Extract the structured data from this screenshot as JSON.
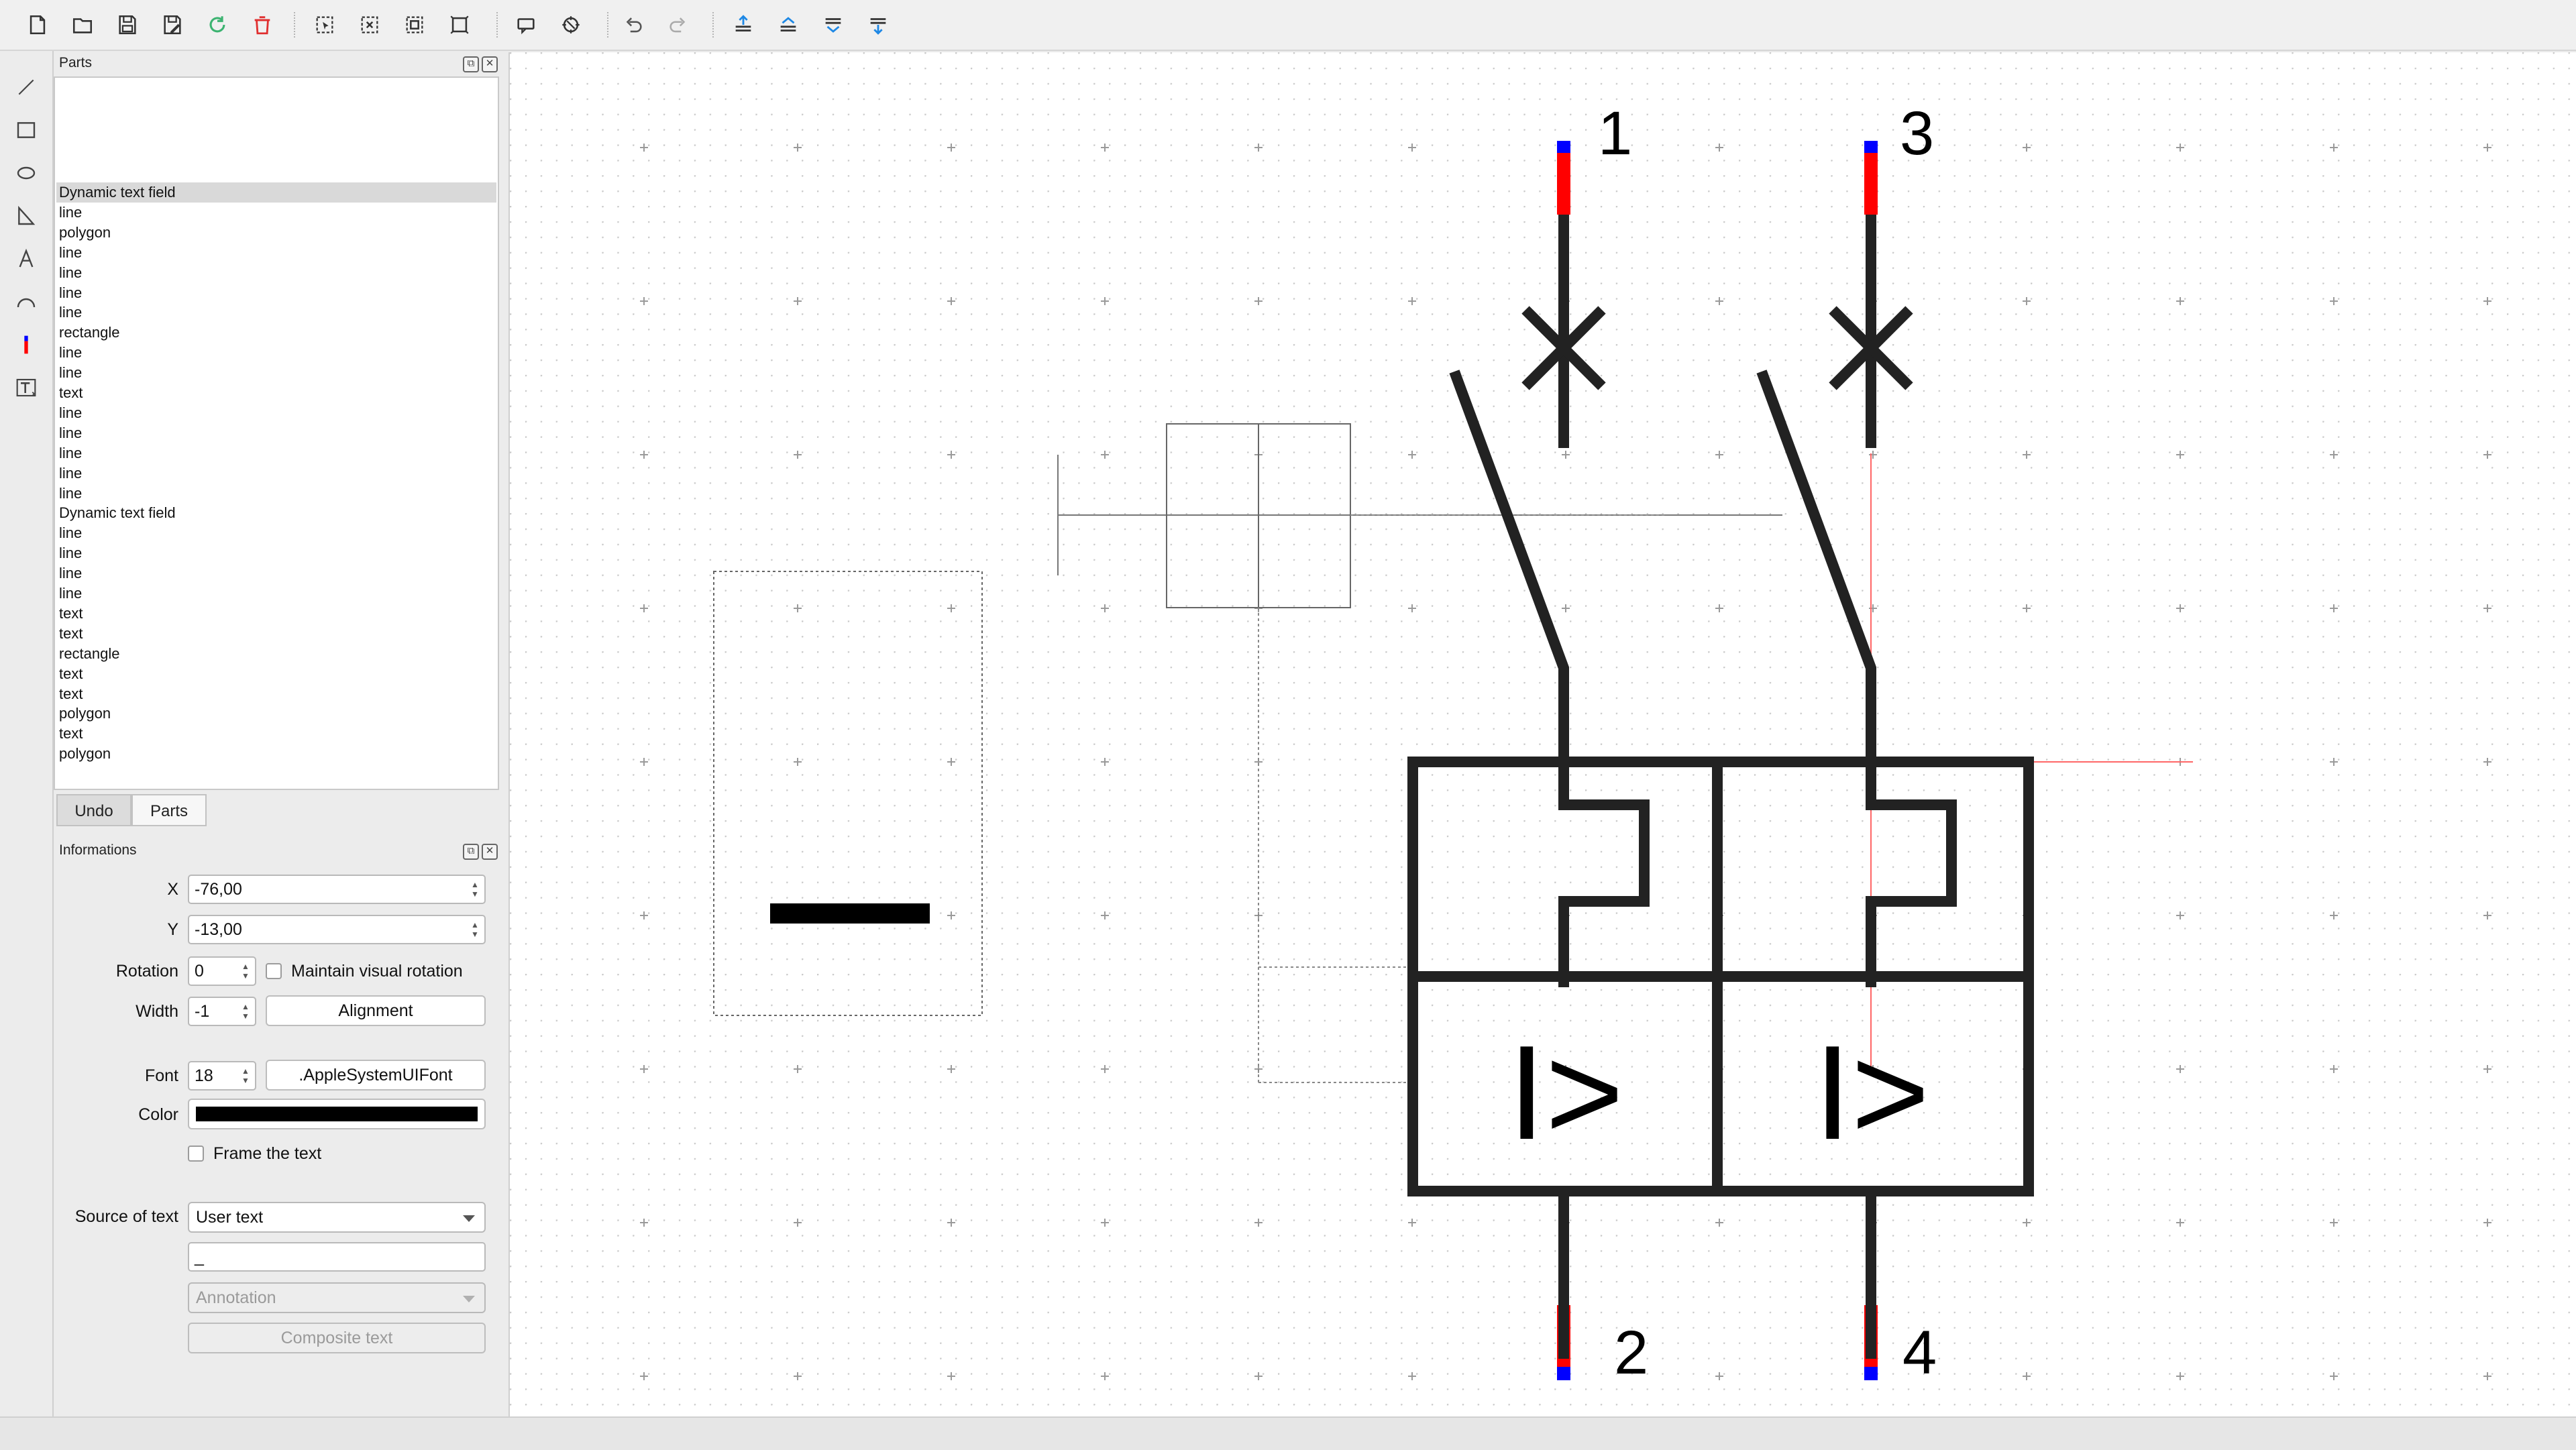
{
  "parts_panel": {
    "title": "Parts",
    "items": [
      "Dynamic text field",
      "line",
      "polygon",
      "line",
      "line",
      "line",
      "line",
      "rectangle",
      "line",
      "line",
      "text",
      "line",
      "line",
      "line",
      "line",
      "line",
      "Dynamic text field",
      "line",
      "line",
      "line",
      "line",
      "text",
      "text",
      "rectangle",
      "text",
      "text",
      "polygon",
      "text",
      "polygon"
    ],
    "selected_index": 0
  },
  "tabs": {
    "undo": "Undo",
    "parts": "Parts"
  },
  "info_panel": {
    "title": "Informations",
    "x_label": "X",
    "x_value": "-76,00",
    "y_label": "Y",
    "y_value": "-13,00",
    "rotation_label": "Rotation",
    "rotation_value": "0",
    "maintain_label": "Maintain visual rotation",
    "width_label": "Width",
    "width_value": "-1",
    "alignment_label": "Alignment",
    "font_label": "Font",
    "font_size": "18",
    "font_button": ".AppleSystemUIFont",
    "color_label": "Color",
    "color_value": "#000000",
    "frame_label": "Frame the text",
    "source_label": "Source of text",
    "source_value": "User text",
    "text_value": "_",
    "annotation_value": "Annotation",
    "composite_label": "Composite text"
  },
  "canvas": {
    "terminal_labels": [
      "1",
      "3",
      "2",
      "4"
    ],
    "function_symbol": "I>",
    "text_field_value": "_",
    "colors": {
      "conductor": "#222222",
      "terminal_red": "#ff0000",
      "terminal_blue": "#0000ff",
      "guide_red": "#ff6666"
    }
  },
  "icons": {
    "toolbar": [
      "new-document-icon",
      "open-folder-icon",
      "save-icon",
      "save-as-icon",
      "reload-icon",
      "delete-icon",
      "select-all-icon",
      "deselect-icon",
      "invert-selection-icon",
      "fit-page-icon",
      "element-properties-icon",
      "scene-settings-icon",
      "undo-icon",
      "redo-icon",
      "bring-to-front-icon",
      "raise-icon",
      "lower-icon",
      "send-to-back-icon"
    ],
    "tools": [
      "line-tool-icon",
      "rectangle-tool-icon",
      "ellipse-tool-icon",
      "polygon-tool-icon",
      "text-tool-icon",
      "arc-tool-icon",
      "terminal-tool-icon",
      "dynamic-text-tool-icon"
    ]
  }
}
